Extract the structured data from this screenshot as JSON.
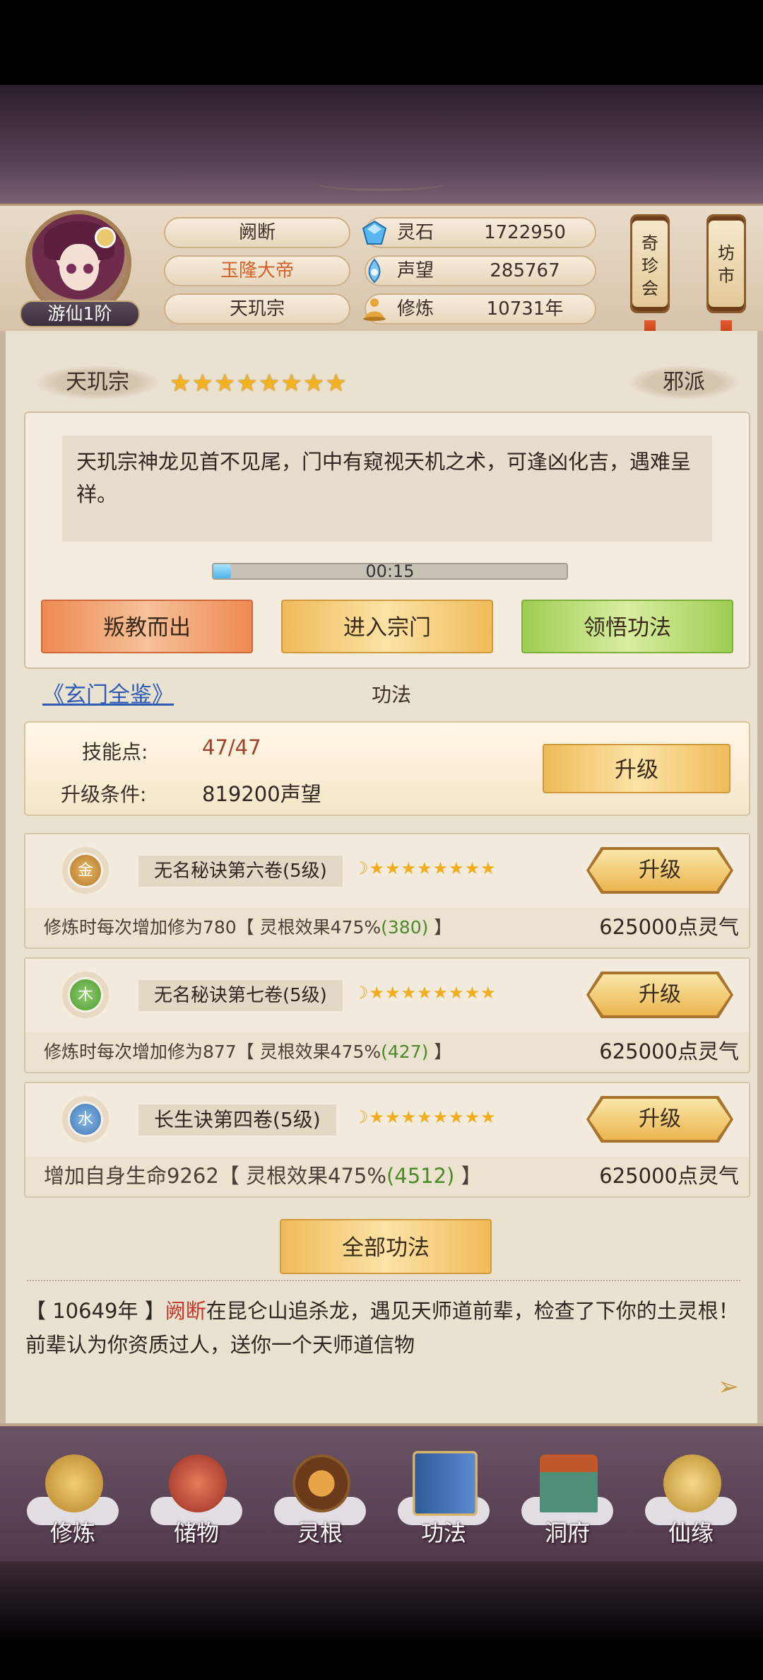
{
  "header": {
    "rank": "游仙1阶",
    "player_name": "阙断",
    "title": "玉隆大帝",
    "sect": "天玑宗",
    "resources": [
      {
        "icon": "spirit-stone-icon",
        "label": "灵石",
        "value": "1722950"
      },
      {
        "icon": "reputation-icon",
        "label": "声望",
        "value": "285767"
      },
      {
        "icon": "cultivation-icon",
        "label": "修炼",
        "value": "10731年"
      }
    ],
    "shop_buttons": [
      {
        "label": "奇\n珍\n会"
      },
      {
        "label": "坊\n市"
      }
    ]
  },
  "sect_panel": {
    "name": "天玑宗",
    "stars": "★★★★★★★★",
    "alignment": "邪派",
    "description": "天玑宗神龙见首不见尾，门中有窥视天机之术，可逢凶化吉，遇难呈祥。",
    "timer": "00:15",
    "timer_progress": 0.05,
    "buttons": {
      "leave": "叛教而出",
      "enter": "进入宗门",
      "learn": "领悟功法"
    }
  },
  "skills": {
    "guide_link": "《玄门全鉴》",
    "section_title": "功法",
    "points_label": "技能点:",
    "points_value": "47/47",
    "condition_label": "升级条件:",
    "condition_value": "819200声望",
    "upgrade_label": "升级",
    "cards": [
      {
        "element": "金",
        "name": "无名秘诀第六卷(5级)",
        "stars": "★★★★★★★★",
        "desc_main": "修炼时每次增加修为780【 灵根效果475%",
        "desc_bonus": "(380)",
        "desc_end": " 】",
        "price": "625000点灵气",
        "button": "升级"
      },
      {
        "element": "木",
        "name": "无名秘诀第七卷(5级)",
        "stars": "★★★★★★★★",
        "desc_main": "修炼时每次增加修为877【 灵根效果475%",
        "desc_bonus": "(427)",
        "desc_end": " 】",
        "price": "625000点灵气",
        "button": "升级"
      },
      {
        "element": "水",
        "name": "长生诀第四卷(5级)",
        "stars": "★★★★★★★★",
        "desc_main": "增加自身生命9262【 灵根效果475%",
        "desc_bonus": "(4512)",
        "desc_end": " 】",
        "price": "625000点灵气",
        "button": "升级"
      }
    ],
    "all_button": "全部功法"
  },
  "log": {
    "year": "【 10649年 】",
    "name": "阙断",
    "text": "在昆仑山追杀龙，遇见天师道前辈，检查了下你的土灵根！前辈认为你资质过人，送你一个天师道信物"
  },
  "nav": [
    {
      "label": "修炼",
      "icon": "cultivate-icon",
      "color": "#c99a3a"
    },
    {
      "label": "储物",
      "icon": "storage-bag-icon",
      "color": "#b3443a"
    },
    {
      "label": "灵根",
      "icon": "spirit-root-icon",
      "color": "#6a3a1a"
    },
    {
      "label": "功法",
      "icon": "skill-book-icon",
      "color": "#3a6aaa"
    },
    {
      "label": "洞府",
      "icon": "cave-house-icon",
      "color": "#a0582a"
    },
    {
      "label": "仙缘",
      "icon": "fortune-icon",
      "color": "#c9a040"
    }
  ]
}
